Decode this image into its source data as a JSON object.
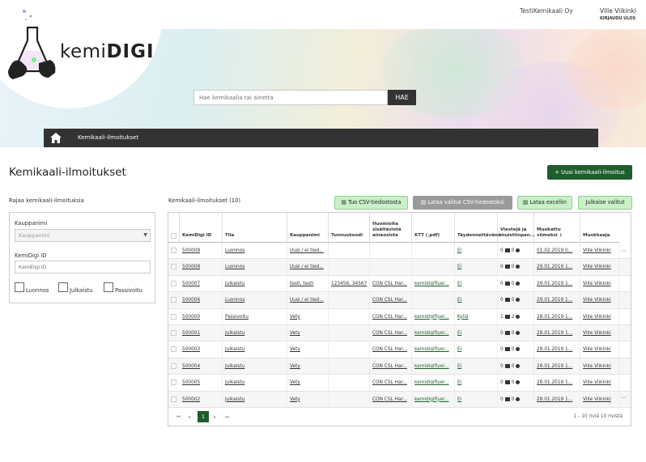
{
  "header": {
    "organization": "TestiKemikaali Oy",
    "user_name": "Ville Viikinki",
    "logout_label": "KIRJAUDU ULOS"
  },
  "logo": {
    "text_light": "kemi",
    "text_bold": "DIGI"
  },
  "search": {
    "placeholder": "Hae kemikaalia tai ainetta",
    "button_label": "HAE"
  },
  "nav": {
    "items": [
      {
        "label": "Kemikaali-ilmoitukset"
      }
    ]
  },
  "page": {
    "title": "Kemikaali-ilmoitukset",
    "new_button_label": "+ Uusi kemikaali-ilmoitus"
  },
  "filter": {
    "title": "Rajaa kemikaali-ilmoituksia",
    "brand_label": "Kauppanimi",
    "brand_placeholder": "Kauppanimi",
    "id_label": "KemiDigi ID",
    "id_placeholder": "KemiDigi ID",
    "status_options": [
      "Luonnos",
      "Julkaistu",
      "Passivoitu"
    ]
  },
  "list": {
    "title": "Kemikaali-ilmoitukset (10)",
    "toolbar": [
      "Tuo CSV-tiedostosta",
      "Lataa valitut CSV-tiedostoksi",
      "Lataa exceliin",
      "Julkaise valitut"
    ],
    "columns": [
      "KemiDigi ID",
      "Tila",
      "Kauppanimi",
      "Tunnuskoodi",
      "Huomioita sisältävistä aineosista",
      "KTT (.pdf)",
      "Täydennettävänä",
      "Viestejä ja muistiinpan...",
      "Muokattu viimeksi ↓",
      "Muokkaaja"
    ],
    "rows": [
      {
        "id": "500009",
        "status": "Luonnos",
        "name": "Uusi / ei tied...",
        "code": "",
        "notes": "",
        "ktt": "",
        "supplement": "Ei",
        "msg": "0",
        "memo": "0",
        "modified": "01.02.2019 0...",
        "editor": "Ville Viikinki"
      },
      {
        "id": "500008",
        "status": "Luonnos",
        "name": "Uusi / ei tied...",
        "code": "",
        "notes": "",
        "ktt": "",
        "supplement": "Ei",
        "msg": "0",
        "memo": "0",
        "modified": "29.01.2019 1...",
        "editor": "Ville Viikinki"
      },
      {
        "id": "500007",
        "status": "Julkaistu",
        "name": "testi, testi",
        "code": "123456, 34567",
        "notes": "CON CSL Har...",
        "ktt": "kemidigiflyer...",
        "supplement": "Ei",
        "msg": "0",
        "memo": "0",
        "modified": "29.01.2019 1...",
        "editor": "Ville Viikinki"
      },
      {
        "id": "500006",
        "status": "Luonnos",
        "name": "Uusi / ei tied...",
        "code": "",
        "notes": "CON CSL Har...",
        "ktt": "",
        "supplement": "Ei",
        "msg": "0",
        "memo": "0",
        "modified": "29.01.2019 1...",
        "editor": "Ville Viikinki"
      },
      {
        "id": "500000",
        "status": "Passivoitu",
        "name": "Vety",
        "code": "",
        "notes": "CON CSL Har...",
        "ktt": "kemidigiflyer...",
        "supplement": "Kyllä",
        "msg": "1",
        "memo": "2",
        "modified": "28.01.2019 1...",
        "editor": "Ville Viikinki"
      },
      {
        "id": "500001",
        "status": "Julkaistu",
        "name": "Vety",
        "code": "",
        "notes": "CON CSL Har...",
        "ktt": "kemidigiflyer...",
        "supplement": "Ei",
        "msg": "0",
        "memo": "0",
        "modified": "28.01.2019 1...",
        "editor": "Ville Viikinki"
      },
      {
        "id": "500003",
        "status": "Julkaistu",
        "name": "Vety",
        "code": "",
        "notes": "CON CSL Har...",
        "ktt": "kemidigiflyer...",
        "supplement": "Ei",
        "msg": "0",
        "memo": "0",
        "modified": "28.01.2019 1...",
        "editor": "Ville Viikinki"
      },
      {
        "id": "500004",
        "status": "Julkaistu",
        "name": "Vety",
        "code": "",
        "notes": "CON CSL Har...",
        "ktt": "kemidigiflyer...",
        "supplement": "Ei",
        "msg": "0",
        "memo": "0",
        "modified": "28.01.2019 1...",
        "editor": "Ville Viikinki"
      },
      {
        "id": "500005",
        "status": "Julkaistu",
        "name": "Vety",
        "code": "",
        "notes": "CON CSL Har...",
        "ktt": "kemidigiflyer...",
        "supplement": "Ei",
        "msg": "0",
        "memo": "0",
        "modified": "28.01.2019 1...",
        "editor": "Ville Viikinki"
      },
      {
        "id": "500002",
        "status": "Julkaistu",
        "name": "Vety",
        "code": "",
        "notes": "CON CSL Har...",
        "ktt": "kemidigiflyer...",
        "supplement": "Ei",
        "msg": "0",
        "memo": "0",
        "modified": "28.01.2019 1...",
        "editor": "Ville Viikinki"
      }
    ],
    "pager": {
      "first": "⏮",
      "prev": "◂",
      "current": "1",
      "next": "▸",
      "last": "⏭",
      "info": "1 - 10 riviä 10 rivistä"
    }
  },
  "colors": {
    "brand_green": "#1e5e2e",
    "button_green_light": "#c9f0c9",
    "nav_dark": "#333333"
  }
}
